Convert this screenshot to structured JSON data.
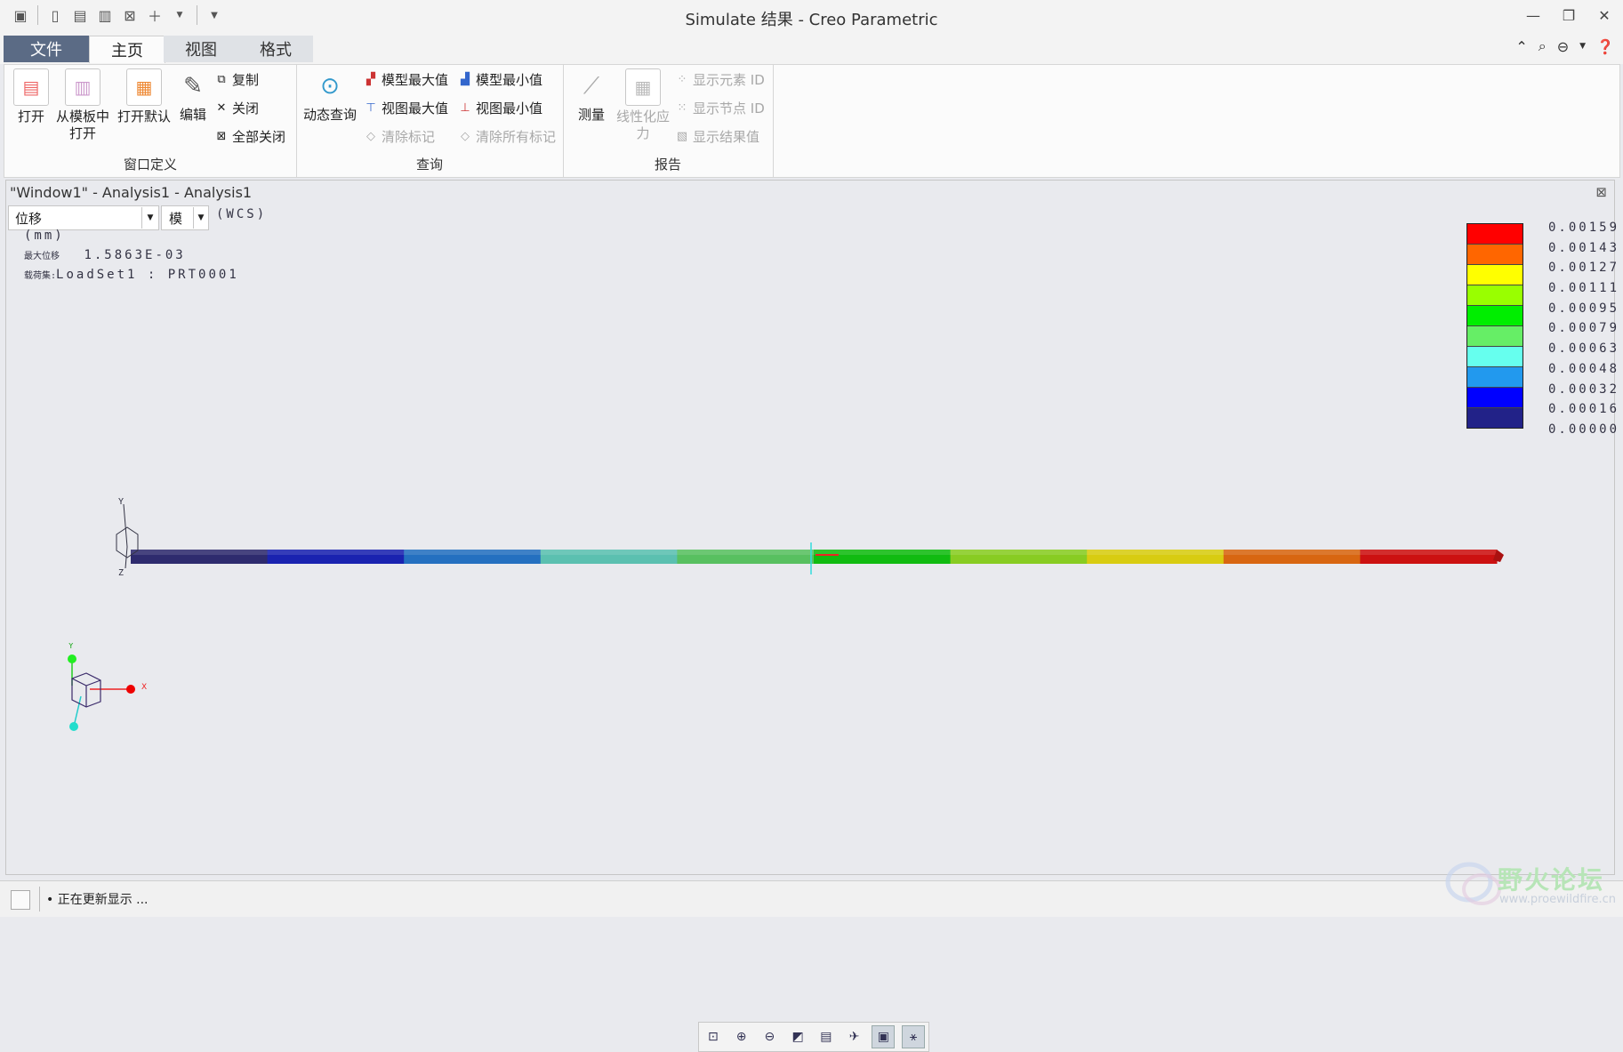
{
  "titlebar": {
    "title": "Simulate 结果 - Creo Parametric",
    "controls": [
      "minimize-icon",
      "maximize-icon",
      "close-icon"
    ]
  },
  "tabs": {
    "file": "文件",
    "home": "主页",
    "view": "视图",
    "format": "格式"
  },
  "ribbon": {
    "window_def": {
      "label": "窗口定义",
      "open": "打开",
      "open_template_l1": "从模板中",
      "open_template_l2": "打开",
      "open_default": "打开默认",
      "edit": "编辑",
      "copy": "复制",
      "close": "关闭",
      "close_all": "全部关闭"
    },
    "query": {
      "label": "查询",
      "dynamic_query": "动态查询",
      "model_max": "模型最大值",
      "model_min": "模型最小值",
      "view_max": "视图最大值",
      "view_min": "视图最小值",
      "clear_marks": "清除标记",
      "clear_all_marks": "清除所有标记"
    },
    "report": {
      "label": "报告",
      "measure": "测量",
      "linearized_stress_l1": "线性化应",
      "linearized_stress_l2": "力",
      "show_element_id": "显示元素 ID",
      "show_node_id": "显示节点 ID",
      "show_result_value": "显示结果值"
    }
  },
  "viewport": {
    "title": "\"Window1\" - Analysis1 - Analysis1",
    "quantity": "位移",
    "component": "模",
    "wcs": "(WCS)",
    "units": "(mm)",
    "max_label": "最大位移",
    "max_value": "1.5863E-03",
    "loadset_label": "载荷集:",
    "loadset_value": "LoadSet1  :   PRT0001"
  },
  "legend": {
    "values": [
      "0.00159",
      "0.00143",
      "0.00127",
      "0.00111",
      "0.00095",
      "0.00079",
      "0.00063",
      "0.00048",
      "0.00032",
      "0.00016",
      "0.00000"
    ],
    "colors": [
      "#ff0000",
      "#ff6600",
      "#ffff00",
      "#99ff00",
      "#00ee00",
      "#66ee66",
      "#66ffee",
      "#2299ee",
      "#0000ff",
      "#222288"
    ]
  },
  "beam": {
    "segment_colors": [
      "#2e2b6e",
      "#1a23b0",
      "#2470c0",
      "#5bc0b0",
      "#58c060",
      "#11bb11",
      "#88cc22",
      "#d8cc11",
      "#d86611",
      "#cc1111"
    ]
  },
  "status": {
    "text": "• 正在更新显示 ..."
  },
  "watermark": {
    "text": "野火论坛",
    "url": "www.proewildfire.cn"
  }
}
